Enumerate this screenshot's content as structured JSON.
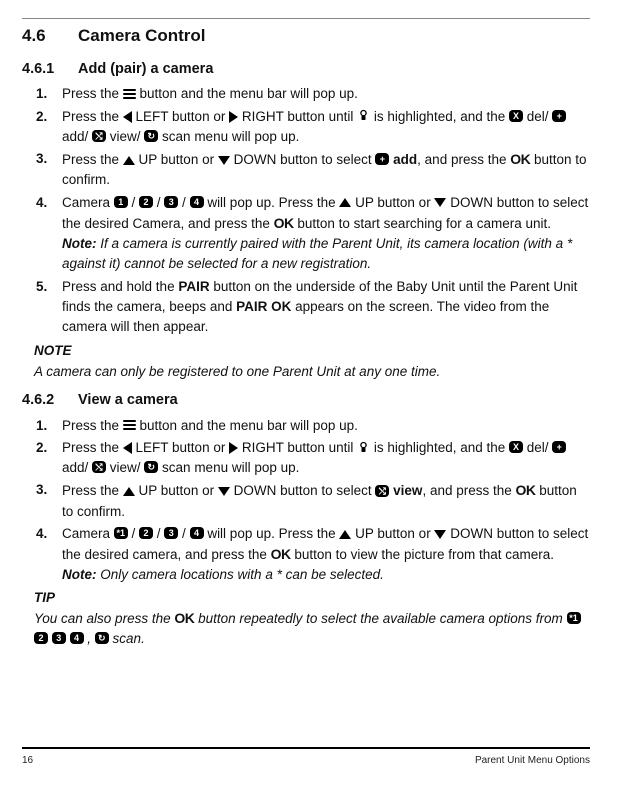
{
  "heading": {
    "num": "4.6",
    "title": "Camera Control"
  },
  "sec1": {
    "num": "4.6.1",
    "title": "Add (pair) a camera",
    "steps": {
      "s1n": "1.",
      "s1": " button and the menu bar will pop up.",
      "s2n": "2.",
      "s2a": " LEFT button or ",
      "s2b": " RIGHT button until ",
      "s2c": " is highlighted, and the ",
      "s2d": " del/ ",
      "s2e": " add/ ",
      "s2f": " view/ ",
      "s2g": " scan menu will pop up.",
      "s3n": "3.",
      "s3a": " UP button or ",
      "s3b": " DOWN button to select ",
      "s3c": " add",
      "s3d": ", and press the ",
      "s3e": " button to confirm.",
      "s4n": "4.",
      "s4a": "Camera ",
      "s4b": " will pop up. Press the ",
      "s4c": " UP button or ",
      "s4d": " DOWN button to select the desired Camera, and press the ",
      "s4e": " button to start searching for a camera unit.",
      "s4note_l": "Note:",
      "s4note": " If a camera is currently paired with the Parent Unit, its camera location (with a * against it) cannot be selected for a new registration.",
      "s5n": "5.",
      "s5a": "Press and hold the ",
      "s5b": "PAIR",
      "s5c": " button on the underside of the Baby Unit until the Parent Unit finds the camera, beeps and ",
      "s5d": "PAIR OK",
      "s5e": " appears on the screen. The video from the camera will then appear."
    },
    "noteH": "NOTE",
    "noteB": " A camera can only be registered to one Parent Unit at any one time."
  },
  "sec2": {
    "num": "4.6.2",
    "title": "View a camera",
    "steps": {
      "s1n": "1.",
      "s1": " button and the menu bar will pop up.",
      "s2n": "2.",
      "s2a": " LEFT button or ",
      "s2b": " RIGHT button until ",
      "s2c": " is highlighted, and the ",
      "s2d": " del/ ",
      "s2e": " add/ ",
      "s2f": " view/ ",
      "s2g": " scan menu will pop up.",
      "s3n": "3.",
      "s3a": " UP button or ",
      "s3b": " DOWN button to select ",
      "s3c": " view",
      "s3d": ", and press the ",
      "s3e": " button to confirm.",
      "s4n": "4.",
      "s4a": "Camera ",
      "s4b": " will pop up. Press the ",
      "s4c": " UP button or ",
      "s4d": " DOWN button to select the desired camera, and press the ",
      "s4e": " button to view the picture from that camera.",
      "s4note_l": "Note:",
      "s4note": " Only camera locations with a * can be selected."
    },
    "tipH": "TIP",
    "tipB1": "You can also press the ",
    "tipB2": " button repeatedly to select the available camera options from ",
    "tipB3": " scan."
  },
  "common": {
    "pressthe": "Press the ",
    "ok": "OK",
    "slash": " / ",
    "comma": " , "
  },
  "icons": {
    "x": "X",
    "plus": "+",
    "swap": "⤭",
    "cycle": "↻",
    "n1": "*1",
    "n1b": "1",
    "n2": "2",
    "n3": "3",
    "n4": "4"
  },
  "footer": {
    "page": "16",
    "section": "Parent Unit Menu Options"
  }
}
